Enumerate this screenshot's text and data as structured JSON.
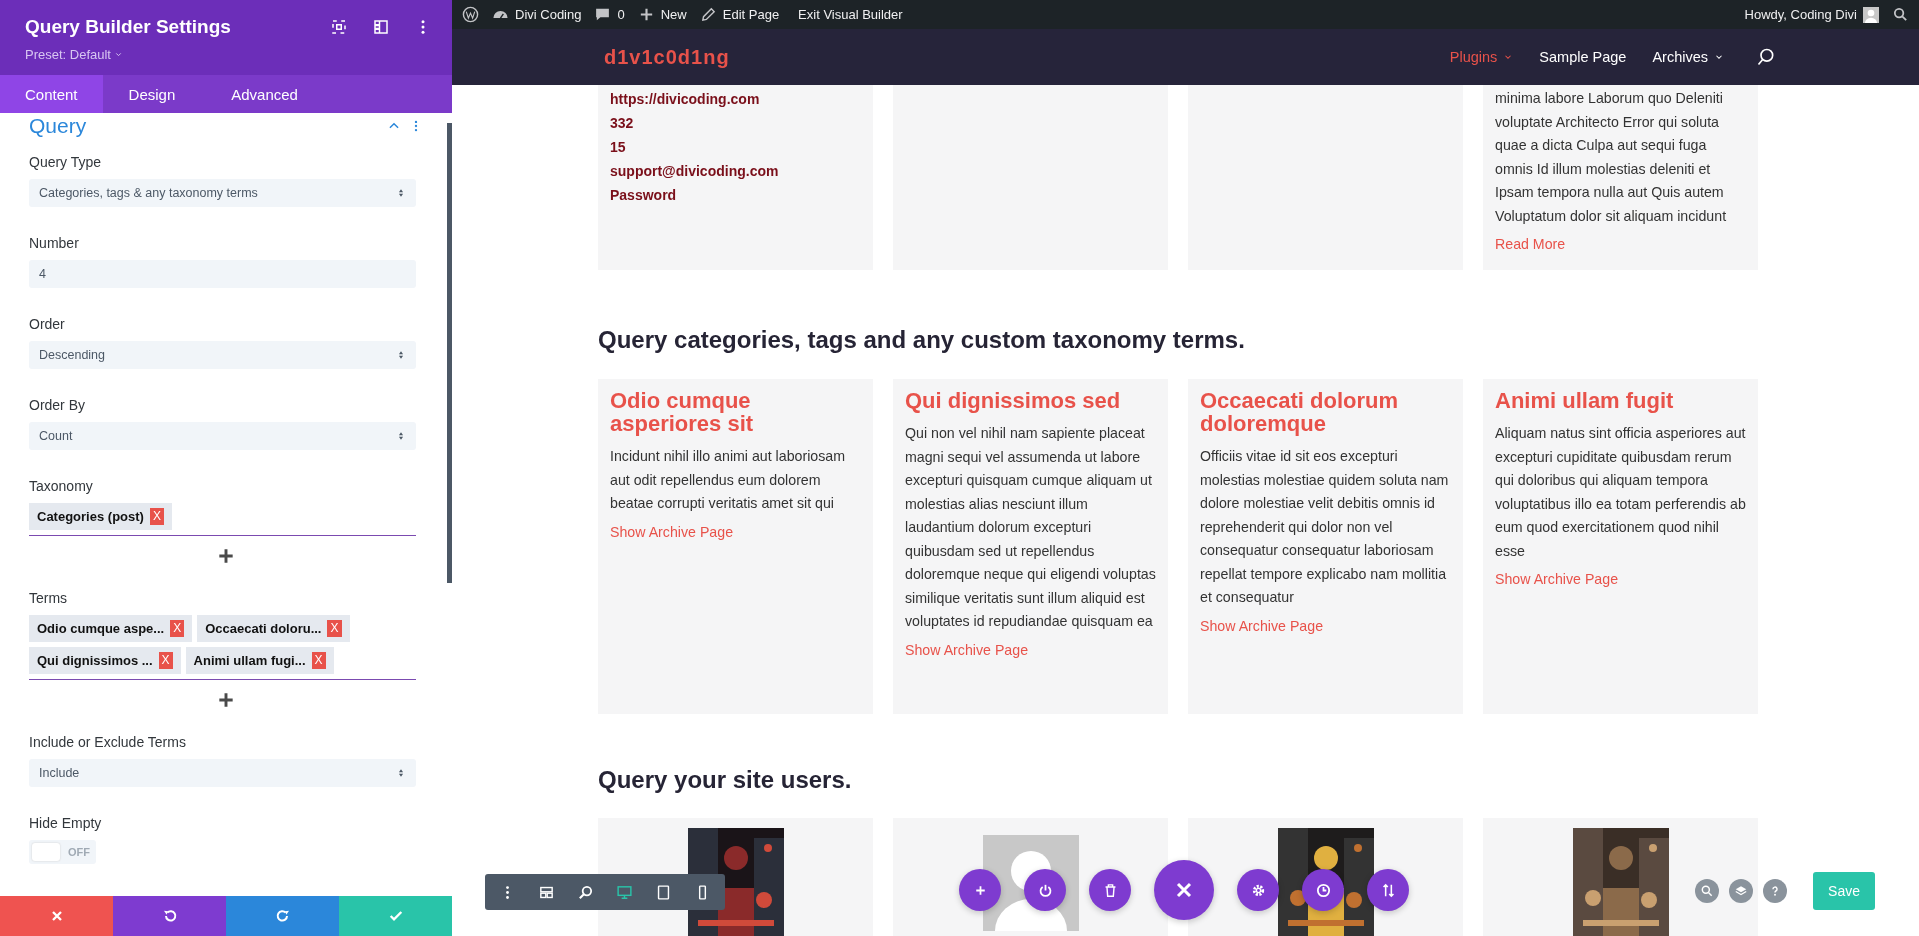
{
  "panel": {
    "title": "Query Builder Settings",
    "preset": "Preset: Default",
    "header_icons": [
      {
        "kind": "expand"
      },
      {
        "kind": "split"
      },
      {
        "kind": "more"
      }
    ],
    "tabs": [
      {
        "label": "Content",
        "selected": true
      },
      {
        "label": "Design",
        "selected": false
      },
      {
        "label": "Advanced",
        "selected": false
      }
    ],
    "section": {
      "title": "Query",
      "expanded": true
    },
    "fields": [
      {
        "kind": "select",
        "label": "Query Type",
        "value": "Categories, tags & any taxonomy terms"
      },
      {
        "kind": "text",
        "label": "Number",
        "value": "4"
      },
      {
        "kind": "select",
        "label": "Order",
        "value": "Descending"
      },
      {
        "kind": "select",
        "label": "Order By",
        "value": "Count"
      },
      {
        "kind": "tags",
        "label": "Taxonomy",
        "tags": [
          {
            "label": "Categories (post)",
            "remove": "X"
          }
        ]
      },
      {
        "kind": "tags",
        "label": "Terms",
        "tags": [
          {
            "label": "Odio cumque aspe...",
            "remove": "X"
          },
          {
            "label": "Occaecati doloru...",
            "remove": "X"
          },
          {
            "label": "Qui dignissimos ...",
            "remove": "X"
          },
          {
            "label": "Animi ullam fugi...",
            "remove": "X"
          }
        ]
      },
      {
        "kind": "select",
        "label": "Include or Exclude Terms",
        "value": "Include"
      },
      {
        "kind": "toggle",
        "label": "Hide Empty",
        "on": false,
        "state_text": "OFF"
      }
    ],
    "footer_buttons": [
      {
        "kind": "cancel"
      },
      {
        "kind": "undo"
      },
      {
        "kind": "redo"
      },
      {
        "kind": "confirm"
      }
    ]
  },
  "admin_bar": {
    "items": [
      {
        "kind": "logo"
      },
      {
        "kind": "site",
        "label": "Divi Coding"
      },
      {
        "kind": "comments",
        "label": "0"
      },
      {
        "kind": "new",
        "label": "New"
      },
      {
        "kind": "edit",
        "label": "Edit Page"
      },
      {
        "kind": "exit",
        "label": "Exit Visual Builder"
      }
    ],
    "greeting": "Howdy, Coding Divi"
  },
  "site_header": {
    "logo": "d1v1c0d1ng",
    "menu": [
      {
        "label": "Plugins",
        "selected": true,
        "dropdown": true
      },
      {
        "label": "Sample Page",
        "selected": false,
        "dropdown": false
      },
      {
        "label": "Archives",
        "selected": false,
        "dropdown": true
      }
    ]
  },
  "top_cards": [
    {
      "kind": "fields",
      "lines": [
        "https://divicoding.com",
        "332",
        "15",
        "support@divicoding.com",
        "Password"
      ]
    },
    {
      "kind": "empty"
    },
    {
      "kind": "empty"
    },
    {
      "kind": "post",
      "text": "minima labore Laborum quo Deleniti voluptate Architecto Error qui soluta quae a dicta Culpa aut sequi fuga omnis Id illum molestias deleniti et Ipsam tempora nulla aut Quis autem Voluptatum dolor sit aliquam incidunt",
      "link": "Read More"
    }
  ],
  "terms_section": {
    "heading": "Query categories, tags and any custom taxonomy terms.",
    "cards": [
      {
        "title": "Odio cumque asperiores sit",
        "text": "Incidunt nihil illo animi aut laboriosam aut odit repellendus eum dolorem beatae corrupti veritatis amet sit qui",
        "link": "Show Archive Page"
      },
      {
        "title": "Qui dignissimos sed",
        "text": "Qui non vel nihil nam sapiente placeat magni sequi vel assumenda ut labore excepturi quisquam cumque aliquam ut molestias alias nesciunt illum laudantium dolorum excepturi quibusdam sed ut repellendus doloremque neque qui eligendi voluptas similique veritatis sunt illum aliquid est voluptates id repudiandae quisquam ea",
        "link": "Show Archive Page"
      },
      {
        "title": "Occaecati dolorum doloremque",
        "text": "Officiis vitae id sit eos excepturi molestias molestiae quidem soluta nam dolore molestiae velit debitis omnis id reprehenderit qui dolor non vel consequatur consequatur laboriosam repellat tempore explicabo nam mollitia et consequatur",
        "link": "Show Archive Page"
      },
      {
        "title": "Animi ullam fugit",
        "text": "Aliquam natus sint officia asperiores aut excepturi cupiditate quibusdam rerum qui doloribus qui aliquam tempora voluptatibus illo ea totam perferendis ab eum quod exercitationem quod nihil esse",
        "link": "Show Archive Page"
      }
    ]
  },
  "users_section": {
    "heading": "Query your site users.",
    "cards": [
      {
        "kind": "picture"
      },
      {
        "kind": "avatar"
      },
      {
        "kind": "picture"
      },
      {
        "kind": "picture"
      }
    ]
  },
  "builder_toolbar": [
    {
      "kind": "menu",
      "selected": false
    },
    {
      "kind": "layout",
      "selected": false
    },
    {
      "kind": "zoom",
      "selected": false
    },
    {
      "kind": "desktop",
      "selected": true
    },
    {
      "kind": "tablet",
      "selected": false
    },
    {
      "kind": "phone",
      "selected": false
    }
  ],
  "module_actions": [
    {
      "kind": "add"
    },
    {
      "kind": "power"
    },
    {
      "kind": "delete"
    },
    {
      "kind": "close"
    },
    {
      "kind": "settings"
    },
    {
      "kind": "history"
    },
    {
      "kind": "sort"
    }
  ],
  "right_controls": [
    {
      "kind": "search"
    },
    {
      "kind": "layers"
    },
    {
      "kind": "help"
    }
  ],
  "save_button": "Save"
}
